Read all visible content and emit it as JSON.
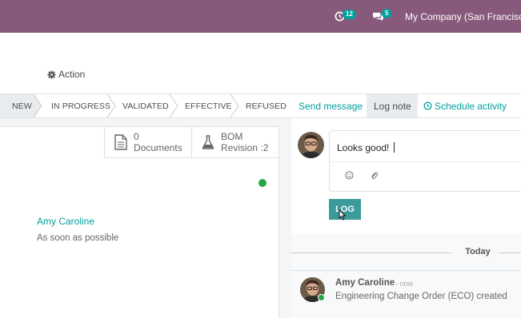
{
  "topbar": {
    "activity_count": "12",
    "message_count": "5",
    "company": "My Company (San Francisco)"
  },
  "toolbar": {
    "action_label": "Action"
  },
  "stages": [
    {
      "label": "NEW",
      "active": true
    },
    {
      "label": "IN PROGRESS",
      "active": false
    },
    {
      "label": "VALIDATED",
      "active": false
    },
    {
      "label": "EFFECTIVE",
      "active": false
    },
    {
      "label": "REFUSED",
      "active": false
    }
  ],
  "chatter": {
    "send_message": "Send message",
    "log_note": "Log note",
    "schedule_activity": "Schedule activity",
    "composer_text": "Looks good!",
    "log_button": "LOG",
    "today_label": "Today",
    "message": {
      "author": "Amy Caroline",
      "time": "- now",
      "body": "Engineering Change Order (ECO) created"
    }
  },
  "smart_buttons": {
    "documents_count": "0",
    "documents_label": "Documents",
    "bom_label": "BOM",
    "bom_revision": "Revision :2"
  },
  "form": {
    "responsible": "Amy Caroline",
    "effectivity": "As soon as possible",
    "status_color": "#28a745"
  },
  "colors": {
    "brand": "#875a7b",
    "accent": "#00a09d",
    "log_button": "#3a9b9a"
  }
}
